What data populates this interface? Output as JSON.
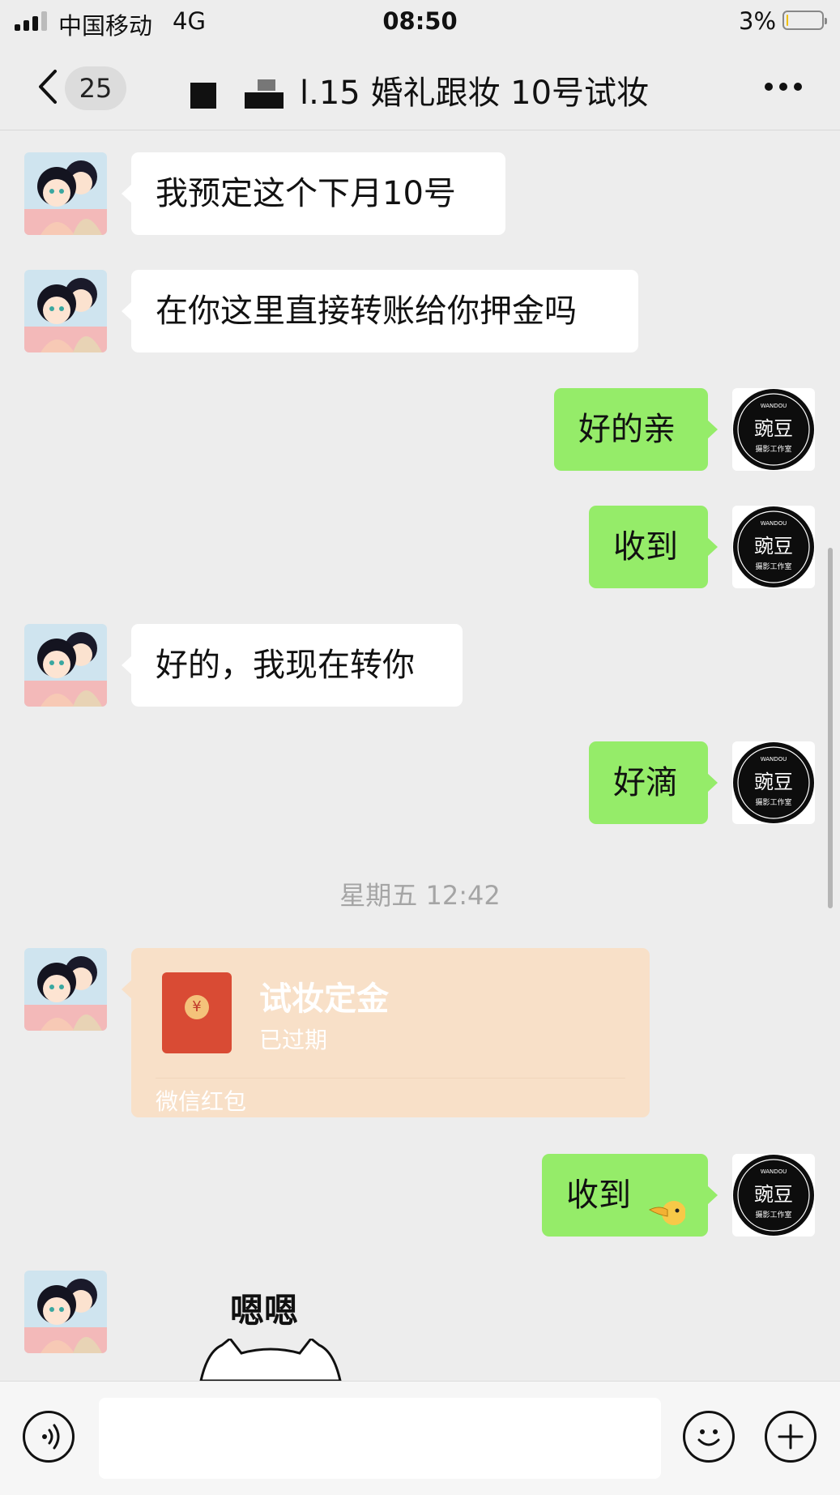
{
  "status_bar": {
    "carrier": "中国移动",
    "network": "4G",
    "time": "08:50",
    "battery_percent": "3%",
    "battery_level": 0.03,
    "icons": [
      "signal-icon",
      "battery-icon"
    ]
  },
  "nav": {
    "unread_count": "25",
    "title": "l.15 婚礼跟妆 10号试妆",
    "icons": [
      "back-icon",
      "more-icon"
    ]
  },
  "avatars": {
    "friend": "cartoon-couple-avatar",
    "studio": {
      "logo_top": "WANDOU",
      "logo_main": "豌豆",
      "logo_sub": "摄影工作室"
    }
  },
  "messages": [
    {
      "sender": "friend",
      "text": "我预定这个下月10号"
    },
    {
      "sender": "friend",
      "text": "在你这里直接转账给你押金吗"
    },
    {
      "sender": "me",
      "text": "好的亲"
    },
    {
      "sender": "me",
      "text": "收到"
    },
    {
      "sender": "friend",
      "text": "好的，我现在转你"
    },
    {
      "sender": "me",
      "text": "好滴"
    },
    {
      "type": "timestamp",
      "text": "星期五 12:42"
    },
    {
      "sender": "friend",
      "type": "red_packet",
      "title": "试妆定金",
      "status": "已过期",
      "footer": "微信红包"
    },
    {
      "sender": "me",
      "text": "收到"
    },
    {
      "sender": "friend",
      "type": "sticker",
      "text": "嗯嗯"
    }
  ],
  "colors": {
    "background": "#ededed",
    "bubble_incoming": "#ffffff",
    "bubble_outgoing": "#95ec69",
    "red_packet": "#f8e0c8",
    "packet_icon": "#d94b34"
  },
  "input_bar": {
    "value": "",
    "icons": [
      "voice-icon",
      "emoji-icon",
      "plus-icon"
    ]
  }
}
